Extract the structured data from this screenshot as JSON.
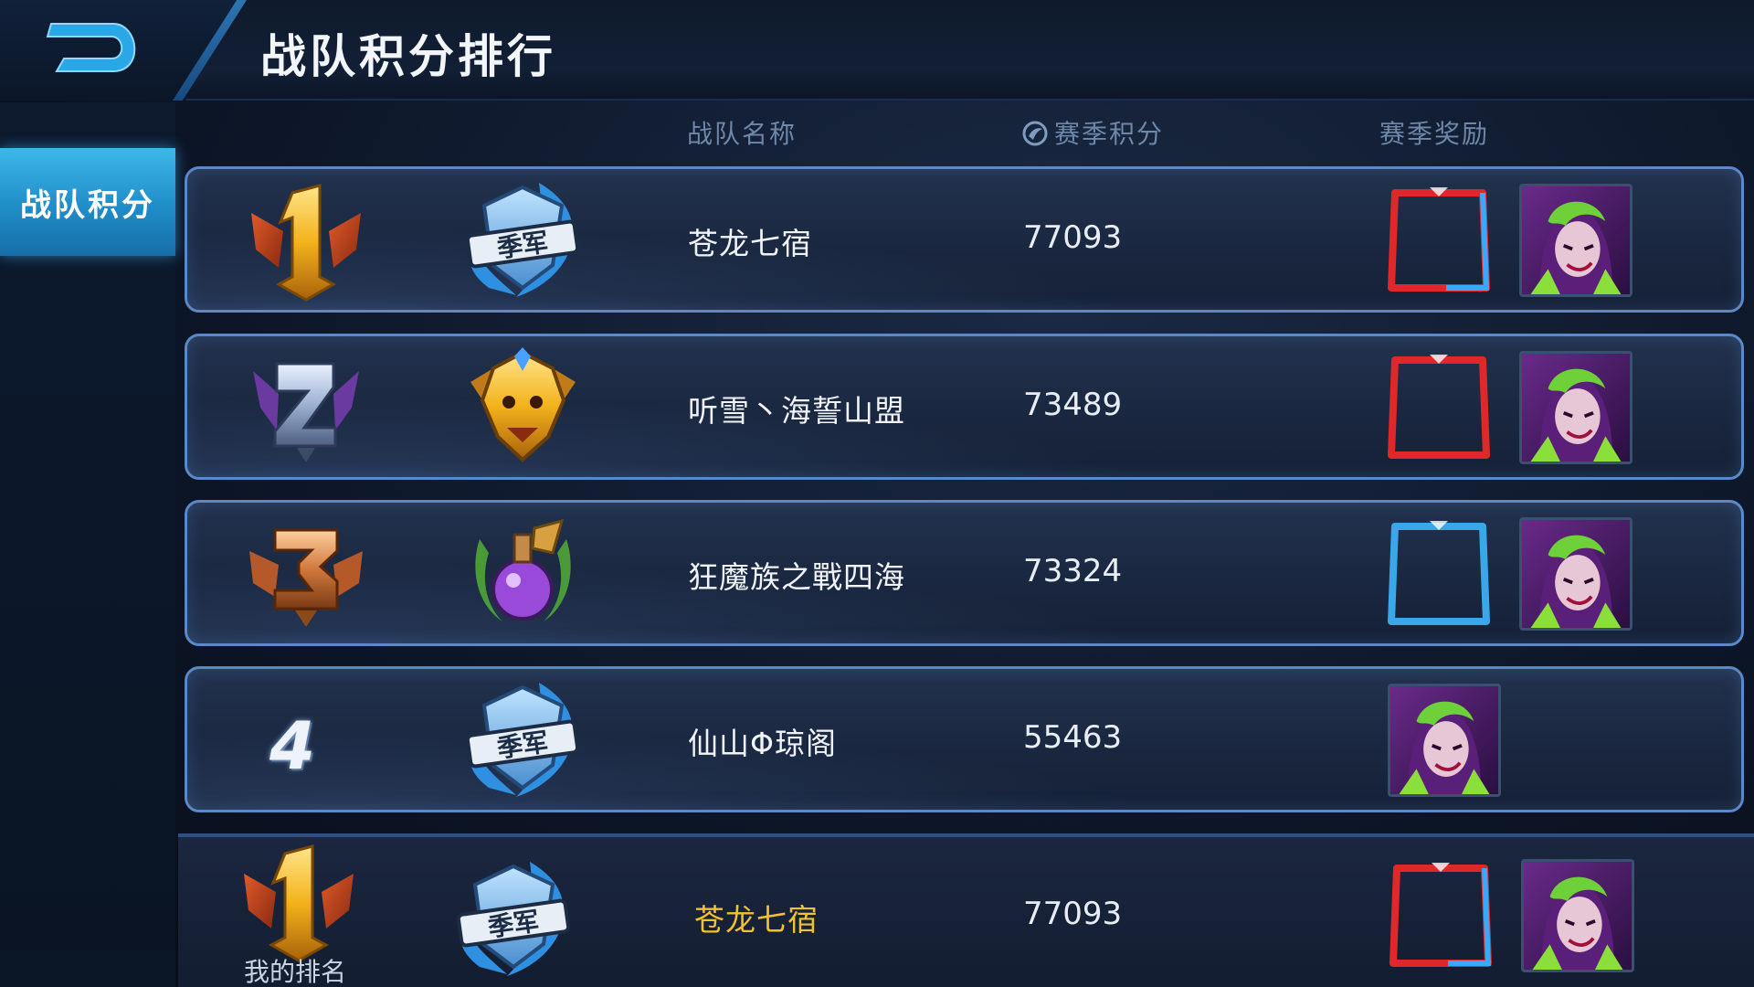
{
  "header": {
    "title": "战队积分排行",
    "back_icon": "back-arrow-icon"
  },
  "sidebar": {
    "tabs": [
      {
        "label": "战队积分",
        "active": true
      }
    ]
  },
  "columns": {
    "team_name": "战队名称",
    "season_points": "赛季积分",
    "season_reward": "赛季奖励"
  },
  "rows": [
    {
      "rank": 1,
      "rank_badge": "gold-rank-1-badge",
      "emblem": "season-runner-up-emblem",
      "team_name": "苍龙七宿",
      "points": "77093",
      "rewards": [
        "red-blue-avatar-frame",
        "hero-avatar"
      ]
    },
    {
      "rank": 2,
      "rank_badge": "silver-rank-2-badge",
      "emblem": "golden-lion-emblem",
      "team_name": "听雪丶海誓山盟",
      "points": "73489",
      "rewards": [
        "red-avatar-frame",
        "hero-avatar"
      ]
    },
    {
      "rank": 3,
      "rank_badge": "bronze-rank-3-badge",
      "emblem": "purple-potion-emblem",
      "team_name": "狂魔族之戰四海",
      "points": "73324",
      "rewards": [
        "blue-avatar-frame",
        "hero-avatar"
      ]
    },
    {
      "rank": 4,
      "rank_label": "4",
      "emblem": "season-runner-up-emblem",
      "team_name": "仙山Φ琼阁",
      "points": "55463",
      "rewards": [
        "hero-avatar"
      ]
    }
  ],
  "my_rank": {
    "label": "我的排名",
    "rank": 1,
    "team_name": "苍龙七宿",
    "points": "77093",
    "rewards": [
      "red-blue-avatar-frame",
      "hero-avatar"
    ]
  },
  "emblem_text": "季军",
  "colors": {
    "accent_blue": "#2a9fd8",
    "my_team_gold": "#f2c12e",
    "row_border": "#5b88c7"
  }
}
